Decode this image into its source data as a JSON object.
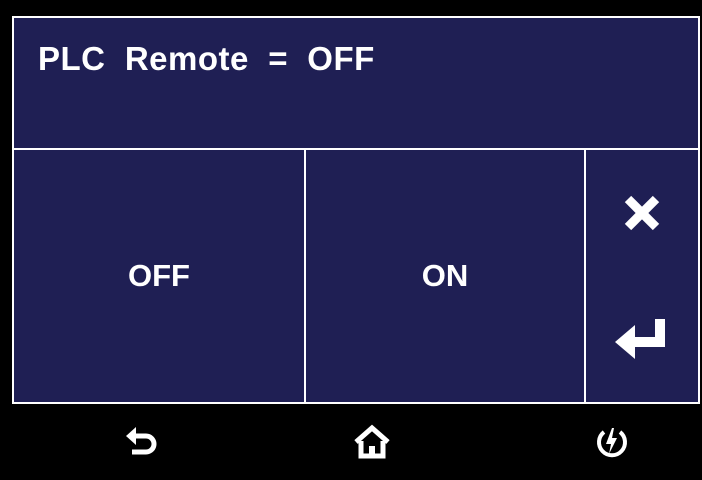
{
  "header": {
    "title": "PLC  Remote  =  OFF"
  },
  "options": [
    {
      "label": "OFF"
    },
    {
      "label": "ON"
    }
  ],
  "side_buttons": {
    "cancel_icon": "close-icon",
    "enter_icon": "enter-icon"
  },
  "footer": {
    "back_icon": "back-icon",
    "home_icon": "home-icon",
    "power_icon": "power-icon"
  },
  "colors": {
    "panel": "#1f1f54",
    "border": "#ffffff",
    "footer": "#000000",
    "text": "#ffffff"
  }
}
